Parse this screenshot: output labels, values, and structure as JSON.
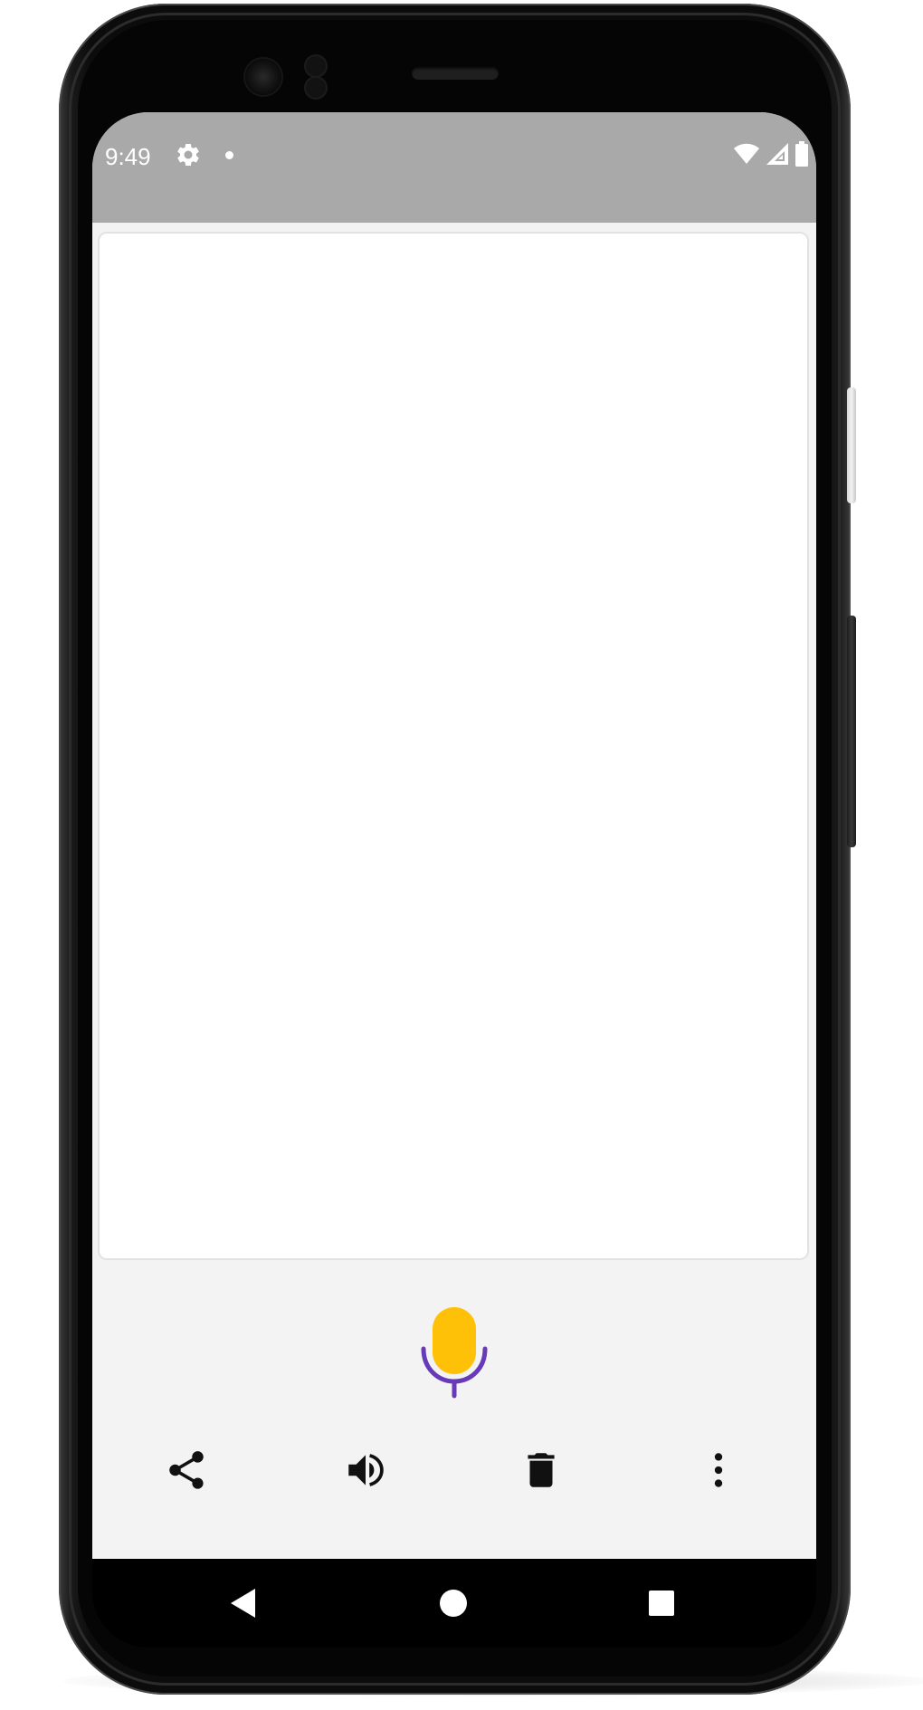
{
  "status_bar": {
    "time": "9:49",
    "left_icons": [
      "settings-icon",
      "notification-dot"
    ],
    "right_icons": [
      "wifi-icon",
      "cellular-signal-icon",
      "battery-icon"
    ],
    "background_color": "#a9a9a9"
  },
  "content": {
    "text": ""
  },
  "mic": {
    "icon": "microphone-icon",
    "body_color": "#ffc107",
    "stand_color": "#673ab7"
  },
  "toolbar": {
    "items": [
      {
        "name": "share",
        "icon": "share-icon"
      },
      {
        "name": "speak",
        "icon": "volume-icon"
      },
      {
        "name": "delete",
        "icon": "trash-icon"
      },
      {
        "name": "more",
        "icon": "more-vertical-icon"
      }
    ]
  },
  "navigation_bar": {
    "buttons": [
      "back-icon",
      "home-icon",
      "recents-icon"
    ]
  }
}
